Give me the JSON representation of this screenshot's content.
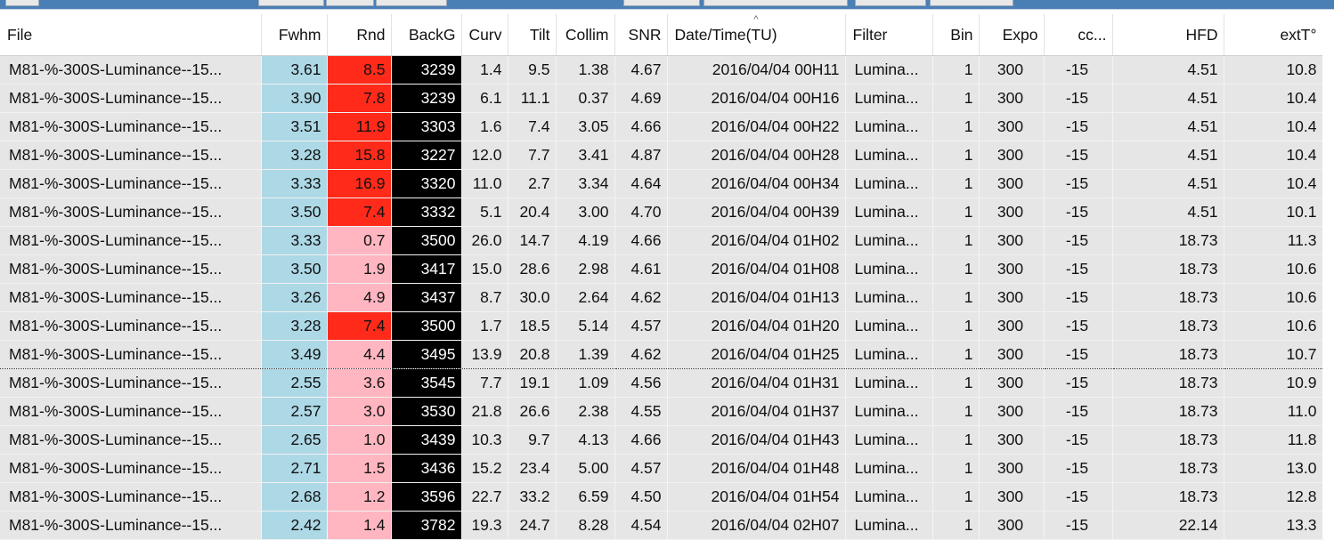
{
  "columns": [
    {
      "key": "file",
      "label": "File"
    },
    {
      "key": "fwhm",
      "label": "Fwhm"
    },
    {
      "key": "rnd",
      "label": "Rnd"
    },
    {
      "key": "backg",
      "label": "BackG"
    },
    {
      "key": "curv",
      "label": "Curv"
    },
    {
      "key": "tilt",
      "label": "Tilt"
    },
    {
      "key": "collim",
      "label": "Collim"
    },
    {
      "key": "snr",
      "label": "SNR"
    },
    {
      "key": "datetime",
      "label": "Date/Time(TU)"
    },
    {
      "key": "filter",
      "label": "Filter"
    },
    {
      "key": "bin",
      "label": "Bin"
    },
    {
      "key": "expo",
      "label": "Expo"
    },
    {
      "key": "cc",
      "label": "cc..."
    },
    {
      "key": "hfd",
      "label": "HFD"
    },
    {
      "key": "extt",
      "label": "extT°"
    }
  ],
  "sort_indicator": "^",
  "colors": {
    "fwhm": "#add8e6",
    "rnd_high": "#ff2a1a",
    "rnd_low": "#ffb6c1",
    "backg": "#000000",
    "row": "#e6e6e6"
  },
  "rows": [
    {
      "file": "M81-%-300S-Luminance--15...",
      "fwhm": "3.61",
      "rnd": "8.5",
      "rnd_level": "high",
      "backg": "3239",
      "curv": "1.4",
      "tilt": "9.5",
      "collim": "1.38",
      "snr": "4.67",
      "datetime": "2016/04/04 00H11",
      "filter": "Lumina...",
      "bin": "1",
      "expo": "300",
      "cc": "-15",
      "hfd": "4.51",
      "extt": "10.8"
    },
    {
      "file": "M81-%-300S-Luminance--15...",
      "fwhm": "3.90",
      "rnd": "7.8",
      "rnd_level": "high",
      "backg": "3239",
      "curv": "6.1",
      "tilt": "11.1",
      "collim": "0.37",
      "snr": "4.69",
      "datetime": "2016/04/04 00H16",
      "filter": "Lumina...",
      "bin": "1",
      "expo": "300",
      "cc": "-15",
      "hfd": "4.51",
      "extt": "10.4"
    },
    {
      "file": "M81-%-300S-Luminance--15...",
      "fwhm": "3.51",
      "rnd": "11.9",
      "rnd_level": "high",
      "backg": "3303",
      "curv": "1.6",
      "tilt": "7.4",
      "collim": "3.05",
      "snr": "4.66",
      "datetime": "2016/04/04 00H22",
      "filter": "Lumina...",
      "bin": "1",
      "expo": "300",
      "cc": "-15",
      "hfd": "4.51",
      "extt": "10.4"
    },
    {
      "file": "M81-%-300S-Luminance--15...",
      "fwhm": "3.28",
      "rnd": "15.8",
      "rnd_level": "high",
      "backg": "3227",
      "curv": "12.0",
      "tilt": "7.7",
      "collim": "3.41",
      "snr": "4.87",
      "datetime": "2016/04/04 00H28",
      "filter": "Lumina...",
      "bin": "1",
      "expo": "300",
      "cc": "-15",
      "hfd": "4.51",
      "extt": "10.4"
    },
    {
      "file": "M81-%-300S-Luminance--15...",
      "fwhm": "3.33",
      "rnd": "16.9",
      "rnd_level": "high",
      "backg": "3320",
      "curv": "11.0",
      "tilt": "2.7",
      "collim": "3.34",
      "snr": "4.64",
      "datetime": "2016/04/04 00H34",
      "filter": "Lumina...",
      "bin": "1",
      "expo": "300",
      "cc": "-15",
      "hfd": "4.51",
      "extt": "10.4"
    },
    {
      "file": "M81-%-300S-Luminance--15...",
      "fwhm": "3.50",
      "rnd": "7.4",
      "rnd_level": "high",
      "backg": "3332",
      "curv": "5.1",
      "tilt": "20.4",
      "collim": "3.00",
      "snr": "4.70",
      "datetime": "2016/04/04 00H39",
      "filter": "Lumina...",
      "bin": "1",
      "expo": "300",
      "cc": "-15",
      "hfd": "4.51",
      "extt": "10.1"
    },
    {
      "file": "M81-%-300S-Luminance--15...",
      "fwhm": "3.33",
      "rnd": "0.7",
      "rnd_level": "low",
      "backg": "3500",
      "curv": "26.0",
      "tilt": "14.7",
      "collim": "4.19",
      "snr": "4.66",
      "datetime": "2016/04/04 01H02",
      "filter": "Lumina...",
      "bin": "1",
      "expo": "300",
      "cc": "-15",
      "hfd": "18.73",
      "extt": "11.3"
    },
    {
      "file": "M81-%-300S-Luminance--15...",
      "fwhm": "3.50",
      "rnd": "1.9",
      "rnd_level": "low",
      "backg": "3417",
      "curv": "15.0",
      "tilt": "28.6",
      "collim": "2.98",
      "snr": "4.61",
      "datetime": "2016/04/04 01H08",
      "filter": "Lumina...",
      "bin": "1",
      "expo": "300",
      "cc": "-15",
      "hfd": "18.73",
      "extt": "10.6"
    },
    {
      "file": "M81-%-300S-Luminance--15...",
      "fwhm": "3.26",
      "rnd": "4.9",
      "rnd_level": "low",
      "backg": "3437",
      "curv": "8.7",
      "tilt": "30.0",
      "collim": "2.64",
      "snr": "4.62",
      "datetime": "2016/04/04 01H13",
      "filter": "Lumina...",
      "bin": "1",
      "expo": "300",
      "cc": "-15",
      "hfd": "18.73",
      "extt": "10.6"
    },
    {
      "file": "M81-%-300S-Luminance--15...",
      "fwhm": "3.28",
      "rnd": "7.4",
      "rnd_level": "high",
      "backg": "3500",
      "curv": "1.7",
      "tilt": "18.5",
      "collim": "5.14",
      "snr": "4.57",
      "datetime": "2016/04/04 01H20",
      "filter": "Lumina...",
      "bin": "1",
      "expo": "300",
      "cc": "-15",
      "hfd": "18.73",
      "extt": "10.6"
    },
    {
      "file": "M81-%-300S-Luminance--15...",
      "fwhm": "3.49",
      "rnd": "4.4",
      "rnd_level": "low",
      "backg": "3495",
      "curv": "13.9",
      "tilt": "20.8",
      "collim": "1.39",
      "snr": "4.62",
      "datetime": "2016/04/04 01H25",
      "filter": "Lumina...",
      "bin": "1",
      "expo": "300",
      "cc": "-15",
      "hfd": "18.73",
      "extt": "10.7",
      "focused": true
    },
    {
      "file": "M81-%-300S-Luminance--15...",
      "fwhm": "2.55",
      "rnd": "3.6",
      "rnd_level": "low",
      "backg": "3545",
      "curv": "7.7",
      "tilt": "19.1",
      "collim": "1.09",
      "snr": "4.56",
      "datetime": "2016/04/04 01H31",
      "filter": "Lumina...",
      "bin": "1",
      "expo": "300",
      "cc": "-15",
      "hfd": "18.73",
      "extt": "10.9"
    },
    {
      "file": "M81-%-300S-Luminance--15...",
      "fwhm": "2.57",
      "rnd": "3.0",
      "rnd_level": "low",
      "backg": "3530",
      "curv": "21.8",
      "tilt": "26.6",
      "collim": "2.38",
      "snr": "4.55",
      "datetime": "2016/04/04 01H37",
      "filter": "Lumina...",
      "bin": "1",
      "expo": "300",
      "cc": "-15",
      "hfd": "18.73",
      "extt": "11.0"
    },
    {
      "file": "M81-%-300S-Luminance--15...",
      "fwhm": "2.65",
      "rnd": "1.0",
      "rnd_level": "low",
      "backg": "3439",
      "curv": "10.3",
      "tilt": "9.7",
      "collim": "4.13",
      "snr": "4.66",
      "datetime": "2016/04/04 01H43",
      "filter": "Lumina...",
      "bin": "1",
      "expo": "300",
      "cc": "-15",
      "hfd": "18.73",
      "extt": "11.8"
    },
    {
      "file": "M81-%-300S-Luminance--15...",
      "fwhm": "2.71",
      "rnd": "1.5",
      "rnd_level": "low",
      "backg": "3436",
      "curv": "15.2",
      "tilt": "23.4",
      "collim": "5.00",
      "snr": "4.57",
      "datetime": "2016/04/04 01H48",
      "filter": "Lumina...",
      "bin": "1",
      "expo": "300",
      "cc": "-15",
      "hfd": "18.73",
      "extt": "13.0"
    },
    {
      "file": "M81-%-300S-Luminance--15...",
      "fwhm": "2.68",
      "rnd": "1.2",
      "rnd_level": "low",
      "backg": "3596",
      "curv": "22.7",
      "tilt": "33.2",
      "collim": "6.59",
      "snr": "4.50",
      "datetime": "2016/04/04 01H54",
      "filter": "Lumina...",
      "bin": "1",
      "expo": "300",
      "cc": "-15",
      "hfd": "18.73",
      "extt": "12.8"
    },
    {
      "file": "M81-%-300S-Luminance--15...",
      "fwhm": "2.42",
      "rnd": "1.4",
      "rnd_level": "low",
      "backg": "3782",
      "curv": "19.3",
      "tilt": "24.7",
      "collim": "8.28",
      "snr": "4.54",
      "datetime": "2016/04/04 02H07",
      "filter": "Lumina...",
      "bin": "1",
      "expo": "300",
      "cc": "-15",
      "hfd": "22.14",
      "extt": "13.3"
    }
  ]
}
